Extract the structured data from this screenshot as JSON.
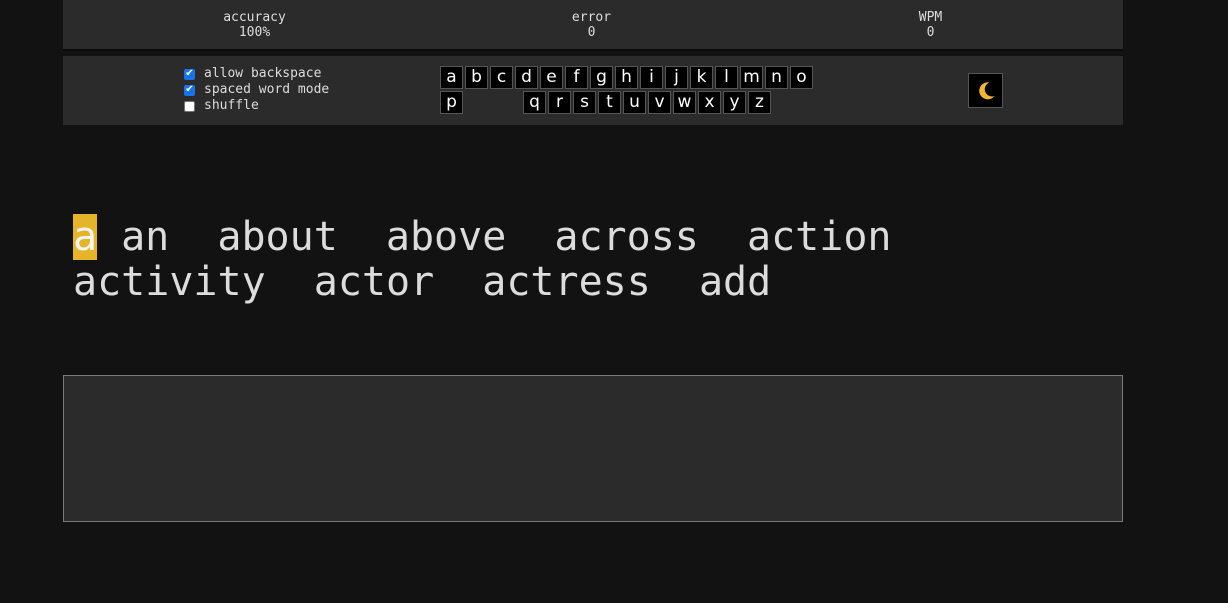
{
  "stats": {
    "accuracy_label": "accuracy",
    "accuracy_value": "100%",
    "error_label": "error",
    "error_value": "0",
    "wpm_label": "WPM",
    "wpm_value": "0"
  },
  "options": [
    {
      "label": "allow backspace",
      "checked": true
    },
    {
      "label": "spaced word mode",
      "checked": true
    },
    {
      "label": "shuffle",
      "checked": false
    }
  ],
  "letters": [
    "a",
    "b",
    "c",
    "d",
    "e",
    "f",
    "g",
    "h",
    "i",
    "j",
    "k",
    "l",
    "m",
    "n",
    "o",
    "p",
    "q",
    "r",
    "s",
    "t",
    "u",
    "v",
    "w",
    "x",
    "y",
    "z"
  ],
  "theme_button": {
    "icon": "moon-icon"
  },
  "words": {
    "cursor_char": "a",
    "list": [
      "an",
      "about",
      "above",
      "across",
      "action",
      "activity",
      "actor",
      "actress",
      "add"
    ]
  },
  "input": {
    "value": ""
  },
  "colors": {
    "background": "#121212",
    "panel": "#2b2b2b",
    "cursor": "#e6b428",
    "moon": "#f2b632"
  }
}
